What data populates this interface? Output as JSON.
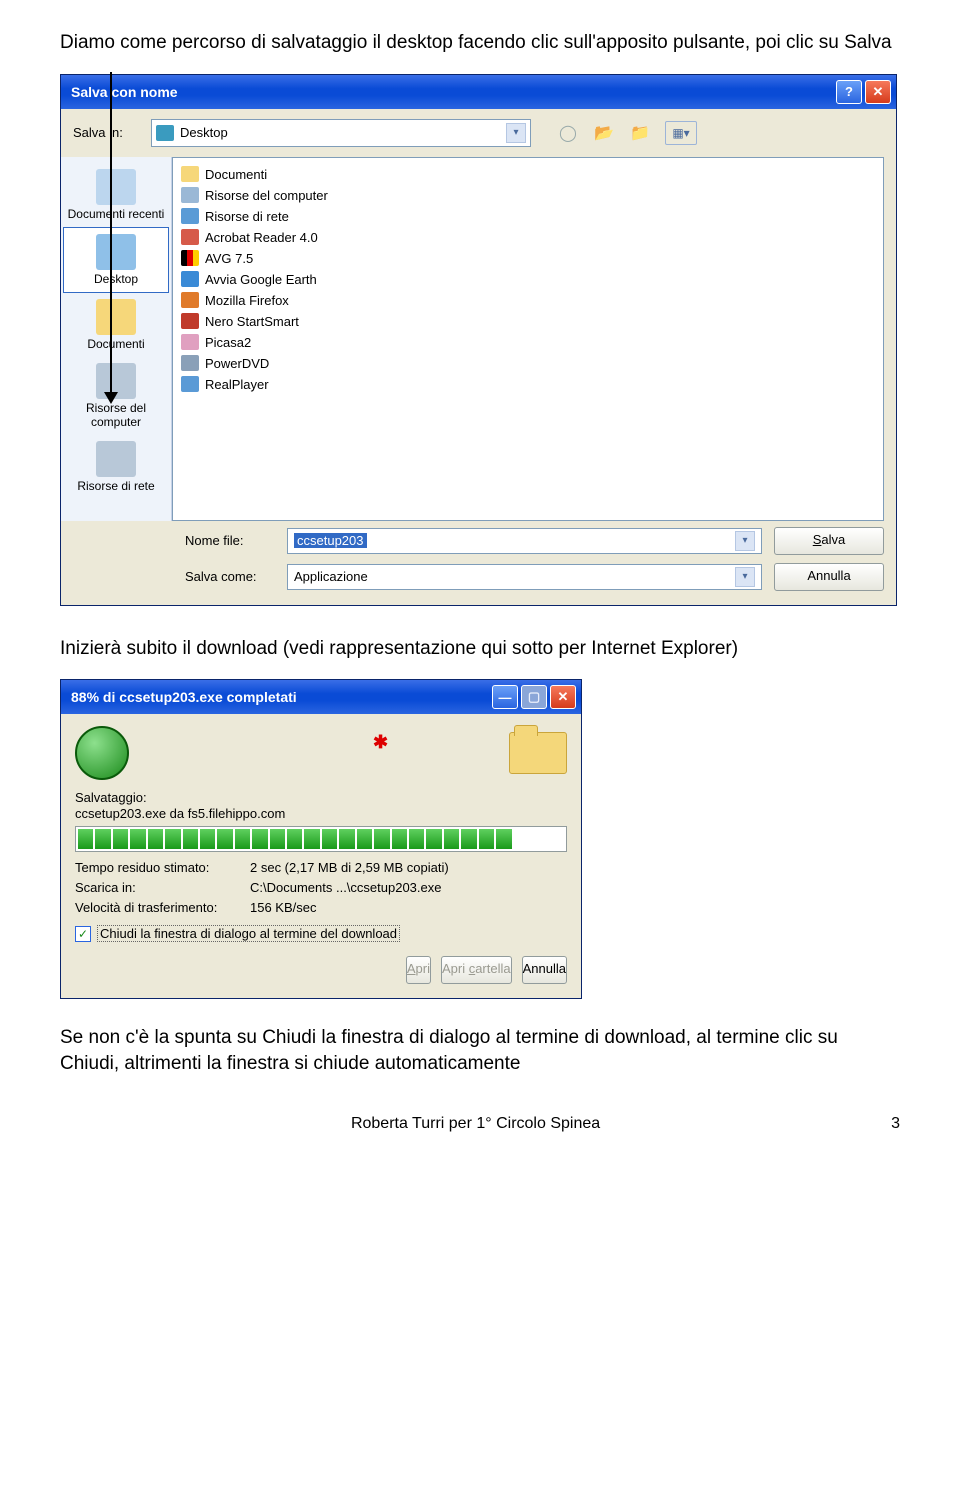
{
  "intro_text": "Diamo come percorso di salvataggio il desktop facendo clic sull'apposito pulsante, poi clic su Salva",
  "mid_text": "Inizierà subito il download (vedi rappresentazione qui sotto per Internet Explorer)",
  "outro_text": "Se non c'è la spunta su Chiudi la finestra di dialogo al termine di download, al termine clic su Chiudi, altrimenti la finestra si chiude automaticamente",
  "footer_left": "Roberta Turri per 1° Circolo Spinea",
  "footer_right": "3",
  "save_dialog": {
    "title": "Salva con nome",
    "savein_label": "Salva in:",
    "savein_value": "Desktop",
    "places": [
      {
        "label": "Documenti recenti"
      },
      {
        "label": "Desktop"
      },
      {
        "label": "Documenti"
      },
      {
        "label": "Risorse del computer"
      },
      {
        "label": "Risorse di rete"
      }
    ],
    "files": [
      "Documenti",
      "Risorse del computer",
      "Risorse di rete",
      "Acrobat Reader 4.0",
      "AVG 7.5",
      "Avvia Google Earth",
      "Mozilla Firefox",
      "Nero StartSmart",
      "Picasa2",
      "PowerDVD",
      "RealPlayer"
    ],
    "filename_label": "Nome file:",
    "filename_value": "ccsetup203",
    "savetype_label": "Salva come:",
    "savetype_value": "Applicazione",
    "save_btn": "Salva",
    "save_btn_u": "S",
    "cancel_btn": "Annulla"
  },
  "progress_dialog": {
    "title": "88% di ccsetup203.exe completati",
    "saving_label": "Salvataggio:",
    "saving_value": "ccsetup203.exe da fs5.filehippo.com",
    "time_label": "Tempo residuo stimato:",
    "time_value": "2 sec (2,17 MB di 2,59 MB copiati)",
    "dest_label": "Scarica in:",
    "dest_value": "C:\\Documents ...\\ccsetup203.exe",
    "speed_label": "Velocità di trasferimento:",
    "speed_value": "156 KB/sec",
    "checkbox_label": "Chiudi la finestra di dialogo al termine del download",
    "open_btn": "Apri",
    "open_btn_u": "A",
    "openf_btn": "Apri cartella",
    "openf_btn_u": "c",
    "cancel_btn": "Annulla"
  }
}
